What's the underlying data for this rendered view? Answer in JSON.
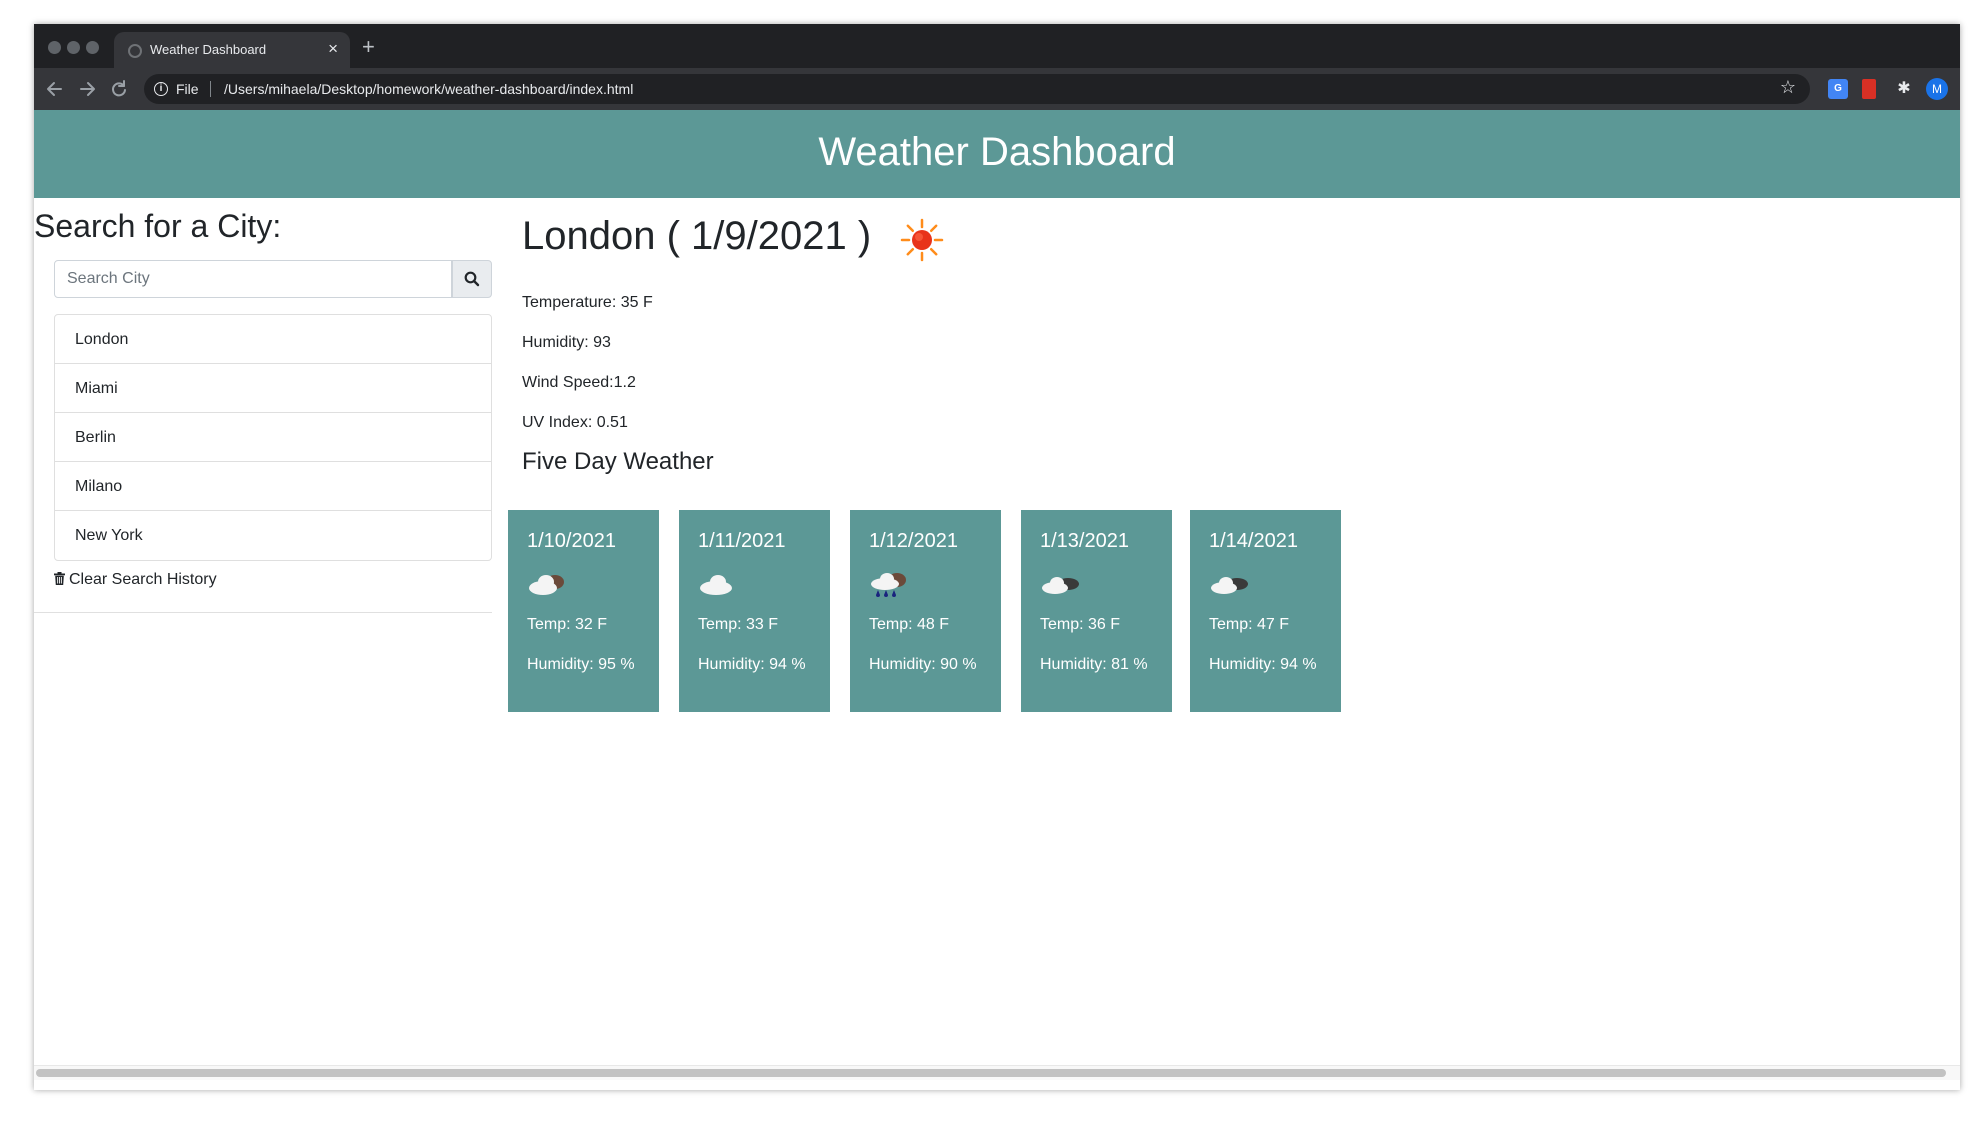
{
  "browser": {
    "tab_title": "Weather Dashboard",
    "tab_close": "×",
    "new_tab": "+",
    "scheme_label": "File",
    "url": "/Users/mihaela/Desktop/homework/weather-dashboard/index.html",
    "profile_initial": "M",
    "translate_icon_text": "G"
  },
  "header": {
    "title": "Weather Dashboard"
  },
  "search": {
    "heading": "Search for a City:",
    "placeholder": "Search City",
    "history": [
      "London",
      "Miami",
      "Berlin",
      "Milano",
      "New York"
    ],
    "clear_label": "Clear Search History"
  },
  "current": {
    "title": "London ( 1/9/2021 )",
    "icon": "sun-icon",
    "temperature": "Temperature: 35 F",
    "humidity": "Humidity: 93",
    "wind": "Wind Speed:1.2",
    "uv": "UV Index: 0.51"
  },
  "forecast": {
    "heading": "Five Day Weather",
    "days": [
      {
        "date": "1/10/2021",
        "icon": "cloud-icon",
        "temp": "Temp: 32 F",
        "humidity": "Humidity: 95 %"
      },
      {
        "date": "1/11/2021",
        "icon": "cloud-icon",
        "temp": "Temp: 33 F",
        "humidity": "Humidity: 94 %"
      },
      {
        "date": "1/12/2021",
        "icon": "rain-cloud-icon",
        "temp": "Temp: 48 F",
        "humidity": "Humidity: 90 %"
      },
      {
        "date": "1/13/2021",
        "icon": "broken-clouds-icon",
        "temp": "Temp: 36 F",
        "humidity": "Humidity: 81 %"
      },
      {
        "date": "1/14/2021",
        "icon": "broken-clouds-icon",
        "temp": "Temp: 47 F",
        "humidity": "Humidity: 94 %"
      }
    ]
  },
  "colors": {
    "accent": "#5c9896",
    "chrome_dark": "#202124",
    "chrome_toolbar": "#35363a"
  }
}
